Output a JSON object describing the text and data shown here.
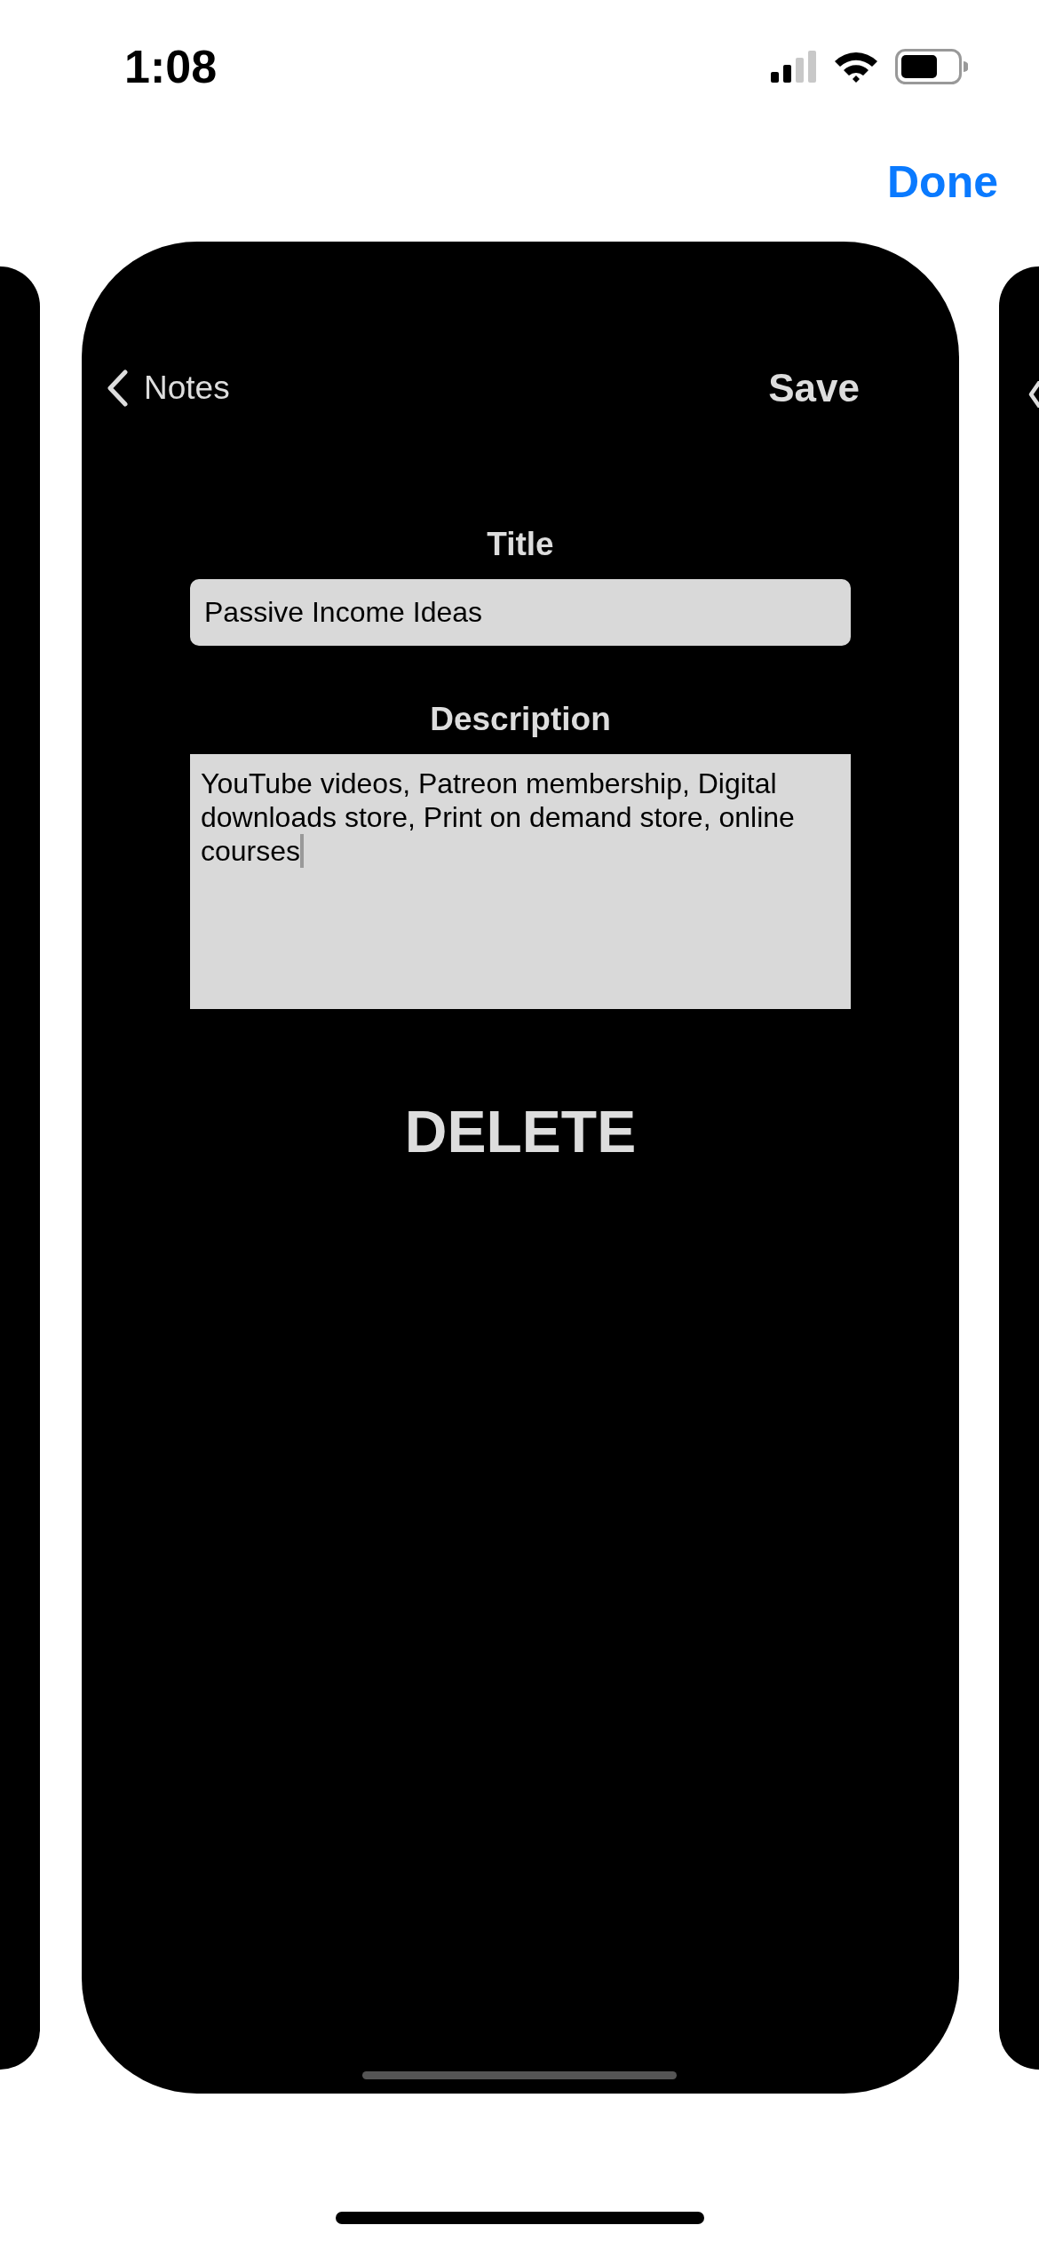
{
  "status_bar": {
    "time": "1:08"
  },
  "done_button": "Done",
  "card": {
    "back_label": "Notes",
    "save_label": "Save",
    "fields": [
      {
        "kind": "line",
        "label": "Title",
        "value": "Passive Income Ideas",
        "focused": false
      },
      {
        "kind": "multiline",
        "label": "Description",
        "value": "YouTube videos, Patreon membership, Digital downloads store, Print on demand store, online courses",
        "focused": true
      }
    ],
    "delete_label": "DELETE"
  }
}
